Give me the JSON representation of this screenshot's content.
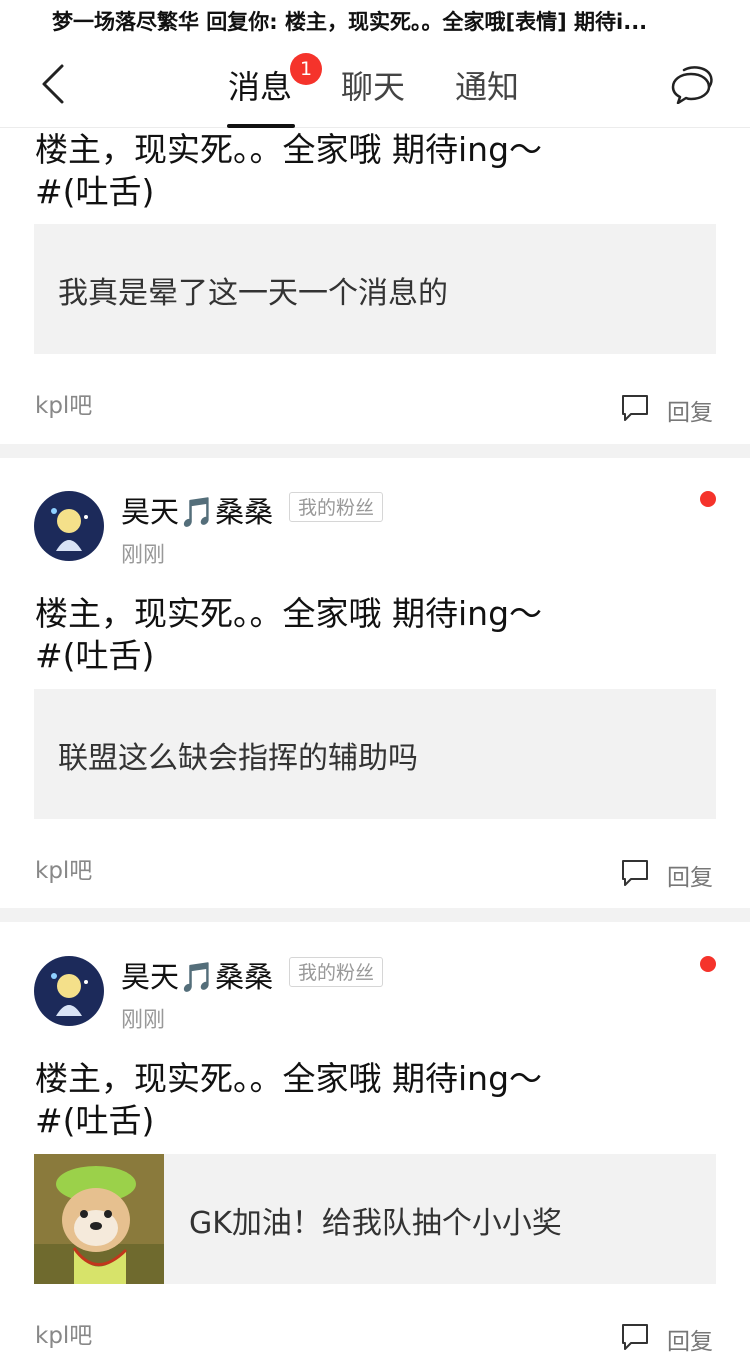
{
  "banner": {
    "text": "梦一场落尽繁华 回复你: 楼主，现实死。。全家哦[表情] 期待i..."
  },
  "nav": {
    "tabs": [
      {
        "label": "消息",
        "badge": "1",
        "active": true
      },
      {
        "label": "聊天"
      },
      {
        "label": "通知"
      }
    ]
  },
  "items": [
    {
      "title_line1": "楼主，现实死。。全家哦 期待ing～",
      "title_line2": "#(吐舌)",
      "quote": "我真是晕了这一天一个消息的",
      "forum": "kpl吧",
      "reply_label": "回复"
    },
    {
      "user": "昊天🎵桑桑",
      "tag": "我的粉丝",
      "time": "刚刚",
      "title_line1": "楼主，现实死。。全家哦 期待ing～",
      "title_line2": "#(吐舌)",
      "quote": "联盟这么缺会指挥的辅助吗",
      "forum": "kpl吧",
      "reply_label": "回复"
    },
    {
      "user": "昊天🎵桑桑",
      "tag": "我的粉丝",
      "time": "刚刚",
      "title_line1": "楼主，现实死。。全家哦 期待ing～",
      "title_line2": "#(吐舌)",
      "quote": "GK加油！给我队抽个小小奖",
      "forum": "kpl吧",
      "reply_label": "回复"
    }
  ],
  "colors": {
    "accent": "#f5332b",
    "quote_bg": "#f2f2f2"
  }
}
